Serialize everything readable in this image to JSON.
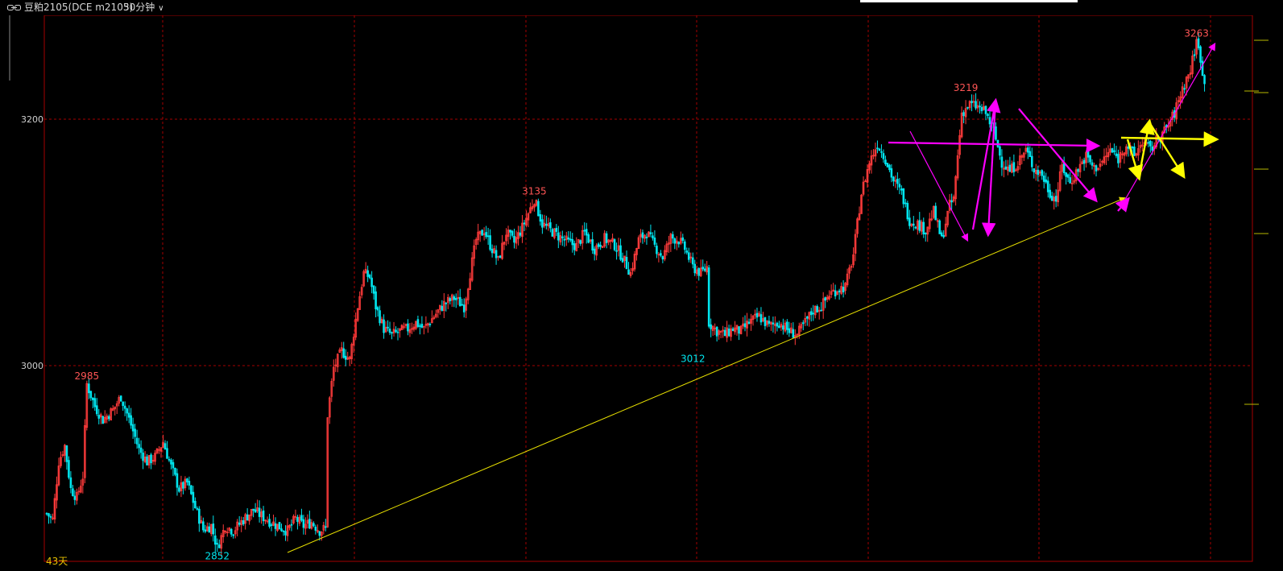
{
  "header": {
    "symbol": "豆粕2105(DCE m2105)",
    "period": "30分钟",
    "link_icon": "link-icon",
    "chevron_icon": "chevron-down-icon"
  },
  "footer": {
    "days_label": "43天"
  },
  "colors": {
    "up": "#ff3b3b",
    "down": "#00e5ee",
    "grid": "#a40000",
    "trend": "#e8e000",
    "magenta": "#ff00ff",
    "yellow": "#ffff00"
  },
  "chart_data": {
    "type": "candlestick",
    "ylim": [
      2840,
      3270
    ],
    "y_ticks": [
      3000,
      3200
    ],
    "grid": true,
    "x_count": 585,
    "annotations": [
      {
        "label": "2985",
        "x": 20,
        "value": 2985,
        "pos": "above",
        "color": "#ff5555"
      },
      {
        "label": "2852",
        "x": 85,
        "value": 2852,
        "pos": "below",
        "color": "#00e5ee"
      },
      {
        "label": "3135",
        "x": 243,
        "value": 3135,
        "pos": "above",
        "color": "#ff5555"
      },
      {
        "label": "3012",
        "x": 322,
        "value": 3012,
        "pos": "below",
        "color": "#00e5ee"
      },
      {
        "label": "3219",
        "x": 458,
        "value": 3219,
        "pos": "above",
        "color": "#ff5555"
      },
      {
        "label": "3263",
        "x": 573,
        "value": 3263,
        "pos": "above",
        "color": "#ff5555"
      }
    ],
    "anchors": [
      [
        0,
        2880
      ],
      [
        3,
        2875
      ],
      [
        6,
        2922
      ],
      [
        9,
        2935
      ],
      [
        12,
        2900
      ],
      [
        15,
        2893
      ],
      [
        18,
        2910
      ],
      [
        20,
        2985
      ],
      [
        24,
        2967
      ],
      [
        28,
        2956
      ],
      [
        33,
        2964
      ],
      [
        37,
        2975
      ],
      [
        42,
        2952
      ],
      [
        46,
        2932
      ],
      [
        50,
        2922
      ],
      [
        54,
        2926
      ],
      [
        58,
        2938
      ],
      [
        62,
        2918
      ],
      [
        66,
        2900
      ],
      [
        70,
        2905
      ],
      [
        74,
        2885
      ],
      [
        78,
        2867
      ],
      [
        82,
        2870
      ],
      [
        85,
        2852
      ],
      [
        89,
        2870
      ],
      [
        93,
        2866
      ],
      [
        98,
        2875
      ],
      [
        103,
        2883
      ],
      [
        107,
        2878
      ],
      [
        111,
        2874
      ],
      [
        115,
        2870
      ],
      [
        120,
        2866
      ],
      [
        124,
        2876
      ],
      [
        128,
        2870
      ],
      [
        132,
        2873
      ],
      [
        136,
        2866
      ],
      [
        139,
        2868
      ],
      [
        140,
        2960
      ],
      [
        143,
        2998
      ],
      [
        147,
        3012
      ],
      [
        151,
        3005
      ],
      [
        155,
        3048
      ],
      [
        158,
        3075
      ],
      [
        161,
        3072
      ],
      [
        164,
        3048
      ],
      [
        168,
        3030
      ],
      [
        172,
        3025
      ],
      [
        176,
        3028
      ],
      [
        180,
        3030
      ],
      [
        184,
        3035
      ],
      [
        188,
        3030
      ],
      [
        193,
        3040
      ],
      [
        198,
        3050
      ],
      [
        203,
        3055
      ],
      [
        208,
        3048
      ],
      [
        211,
        3075
      ],
      [
        214,
        3102
      ],
      [
        218,
        3110
      ],
      [
        221,
        3098
      ],
      [
        225,
        3085
      ],
      [
        229,
        3108
      ],
      [
        233,
        3100
      ],
      [
        237,
        3112
      ],
      [
        243,
        3135
      ],
      [
        247,
        3115
      ],
      [
        251,
        3110
      ],
      [
        256,
        3104
      ],
      [
        260,
        3100
      ],
      [
        264,
        3097
      ],
      [
        268,
        3108
      ],
      [
        273,
        3095
      ],
      [
        278,
        3103
      ],
      [
        283,
        3098
      ],
      [
        287,
        3088
      ],
      [
        291,
        3075
      ],
      [
        295,
        3102
      ],
      [
        299,
        3108
      ],
      [
        303,
        3097
      ],
      [
        307,
        3088
      ],
      [
        311,
        3104
      ],
      [
        315,
        3102
      ],
      [
        318,
        3095
      ],
      [
        322,
        3080
      ],
      [
        326,
        3075
      ],
      [
        329,
        3080
      ],
      [
        330,
        3035
      ],
      [
        334,
        3028
      ],
      [
        338,
        3025
      ],
      [
        342,
        3030
      ],
      [
        346,
        3028
      ],
      [
        350,
        3035
      ],
      [
        355,
        3040
      ],
      [
        360,
        3032
      ],
      [
        365,
        3035
      ],
      [
        370,
        3028
      ],
      [
        374,
        3025
      ],
      [
        378,
        3035
      ],
      [
        382,
        3045
      ],
      [
        386,
        3048
      ],
      [
        390,
        3058
      ],
      [
        394,
        3062
      ],
      [
        398,
        3064
      ],
      [
        402,
        3090
      ],
      [
        406,
        3140
      ],
      [
        410,
        3165
      ],
      [
        414,
        3180
      ],
      [
        418,
        3168
      ],
      [
        422,
        3150
      ],
      [
        426,
        3140
      ],
      [
        430,
        3118
      ],
      [
        434,
        3115
      ],
      [
        438,
        3110
      ],
      [
        442,
        3125
      ],
      [
        446,
        3102
      ],
      [
        450,
        3130
      ],
      [
        452,
        3135
      ],
      [
        456,
        3205
      ],
      [
        460,
        3212
      ],
      [
        464,
        3210
      ],
      [
        468,
        3205
      ],
      [
        472,
        3190
      ],
      [
        476,
        3165
      ],
      [
        480,
        3158
      ],
      [
        484,
        3165
      ],
      [
        488,
        3175
      ],
      [
        492,
        3160
      ],
      [
        496,
        3155
      ],
      [
        500,
        3140
      ],
      [
        503,
        3135
      ],
      [
        506,
        3162
      ],
      [
        510,
        3148
      ],
      [
        514,
        3160
      ],
      [
        518,
        3170
      ],
      [
        522,
        3160
      ],
      [
        526,
        3165
      ],
      [
        530,
        3175
      ],
      [
        534,
        3168
      ],
      [
        538,
        3180
      ],
      [
        542,
        3170
      ],
      [
        546,
        3182
      ],
      [
        550,
        3175
      ],
      [
        554,
        3185
      ],
      [
        558,
        3192
      ],
      [
        562,
        3205
      ],
      [
        566,
        3225
      ],
      [
        570,
        3240
      ],
      [
        573,
        3263
      ],
      [
        575,
        3250
      ],
      [
        577,
        3228
      ]
    ]
  }
}
